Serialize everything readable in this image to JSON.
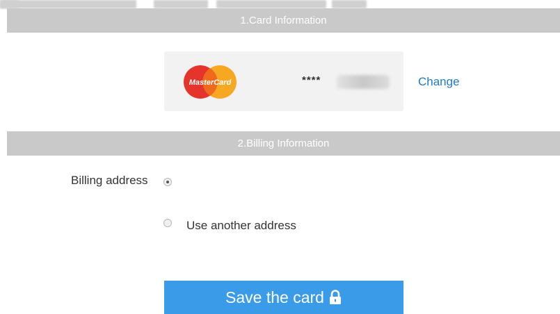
{
  "sections": {
    "card_info_title": "1.Card Information",
    "billing_info_title": "2.Billing Information"
  },
  "card": {
    "brand": "MasterCard",
    "number_mask": "****",
    "change_label": "Change"
  },
  "billing": {
    "label": "Billing address",
    "saved_address_selected": true,
    "other_address_label": "Use another address"
  },
  "save_button": {
    "label": "Save the card",
    "icon": "lock-icon"
  },
  "colors": {
    "section_bar": "#c9c9c9",
    "link": "#1e7ac6",
    "button": "#3a9be8",
    "mastercard_red": "#e5342b",
    "mastercard_yellow": "#f7a823"
  }
}
